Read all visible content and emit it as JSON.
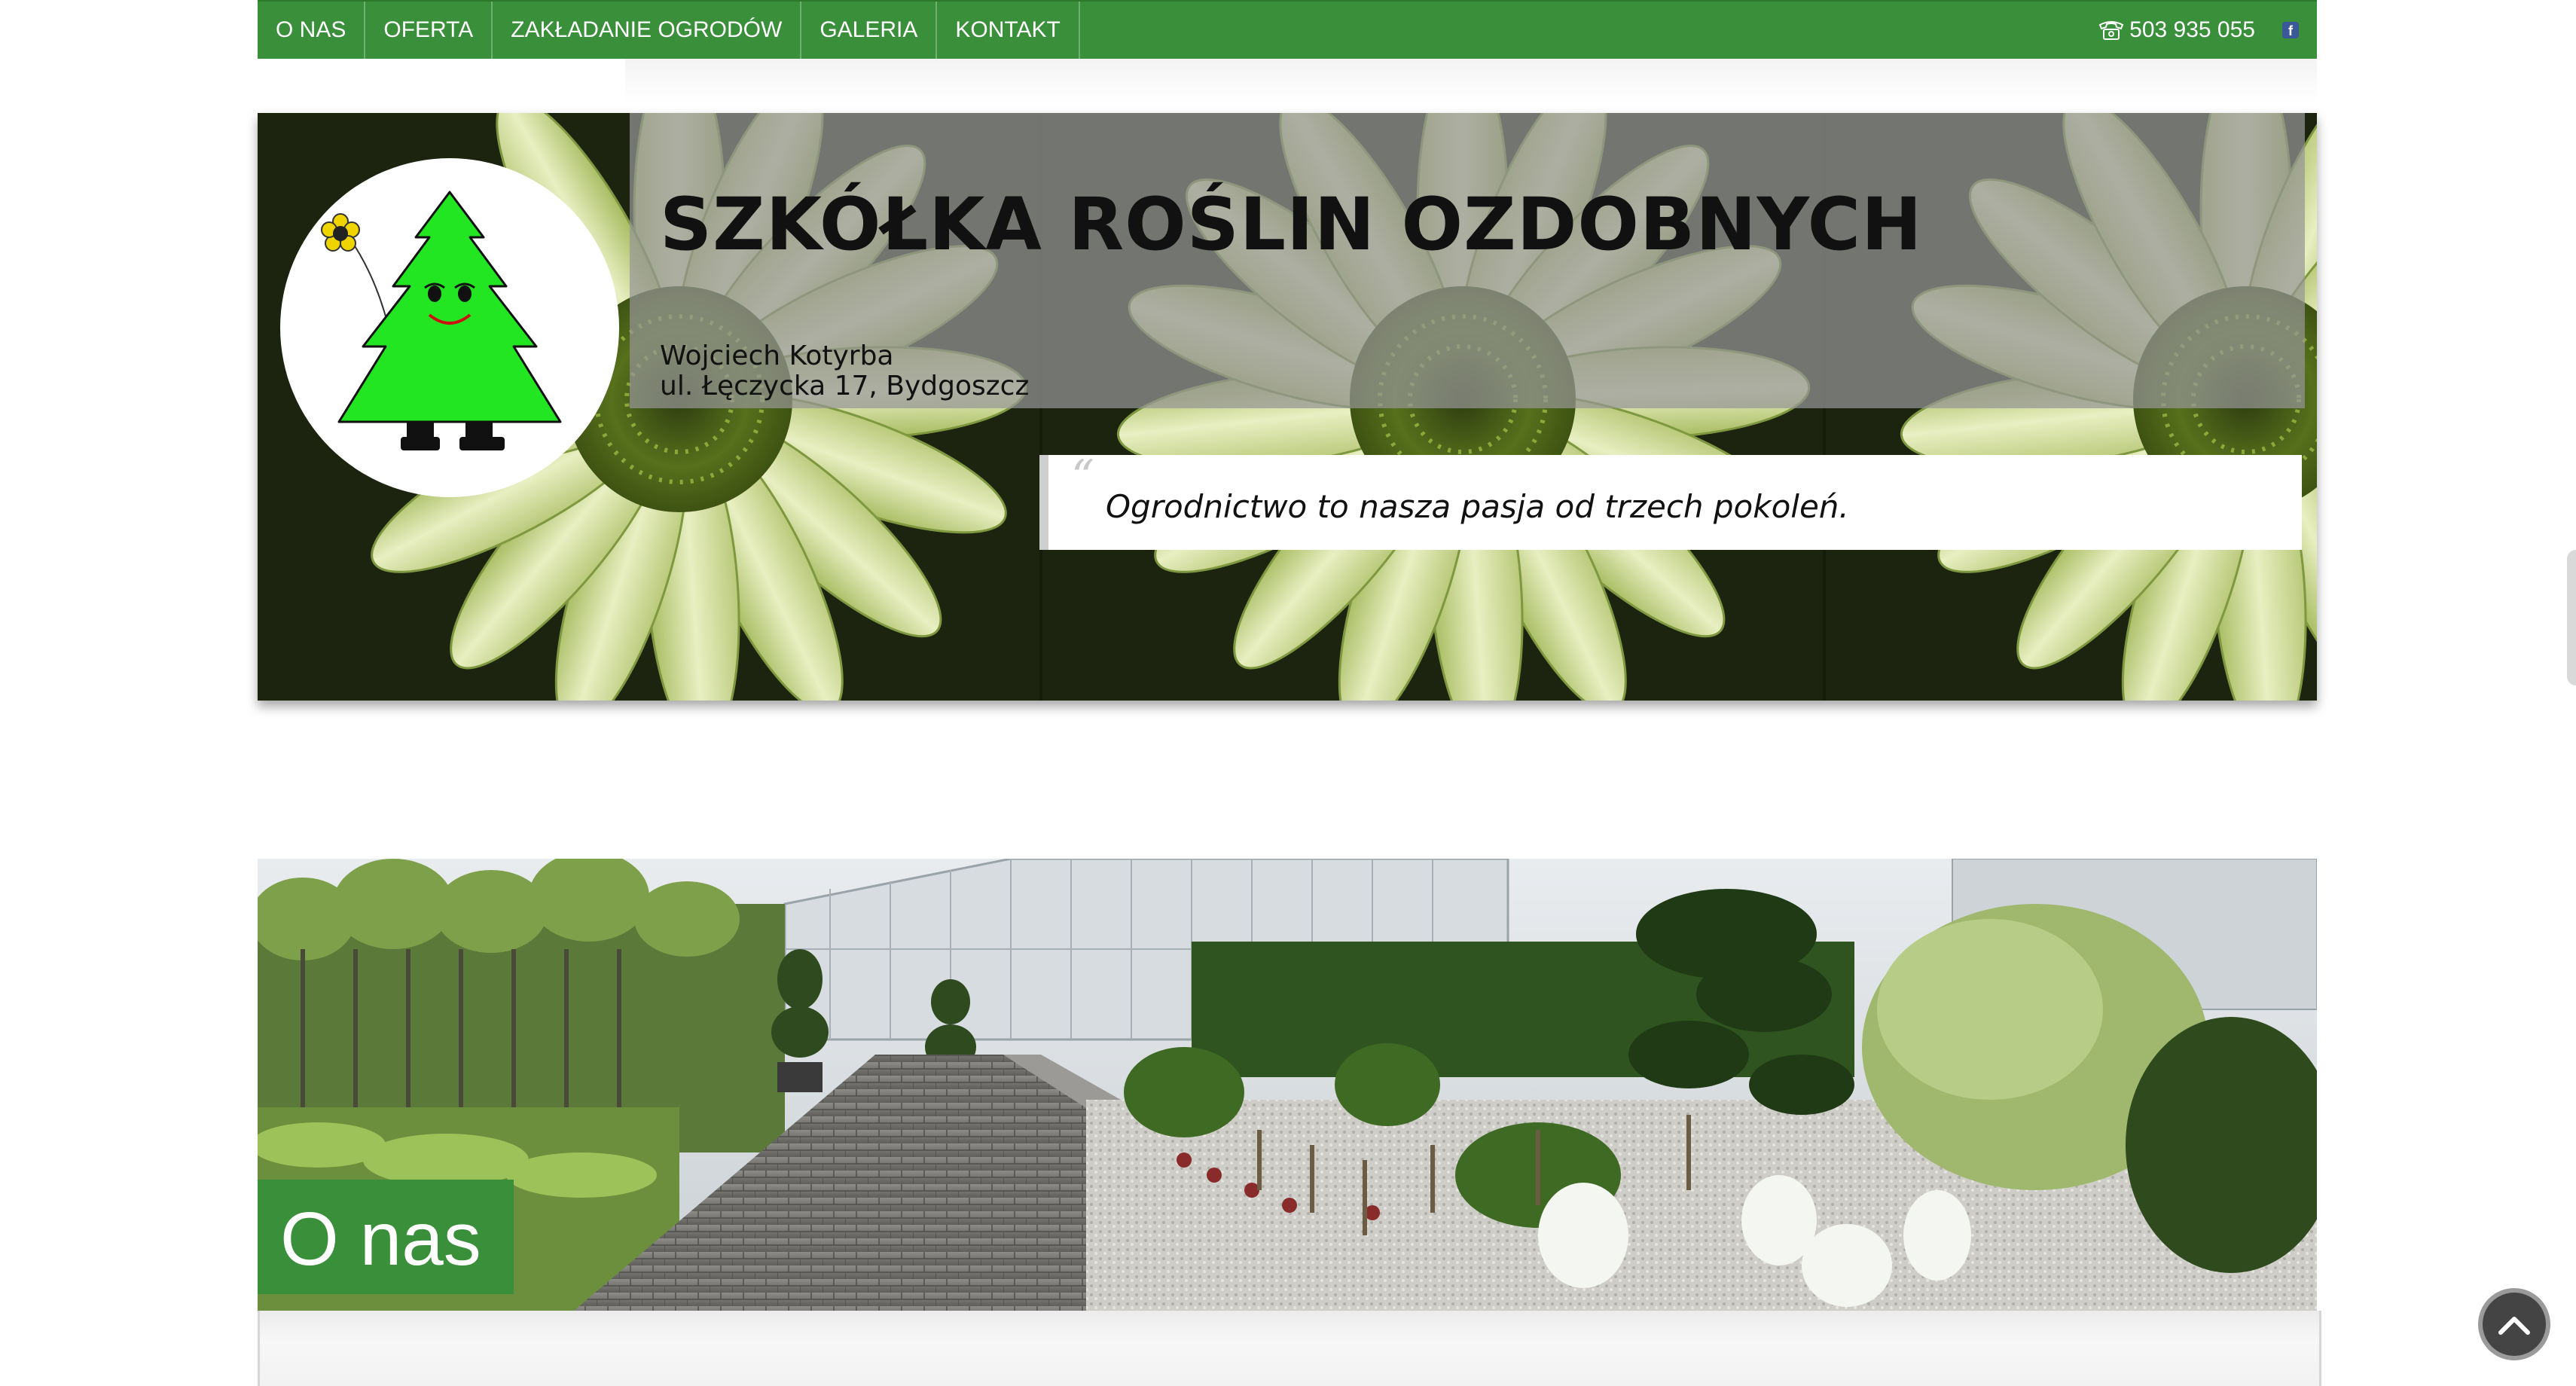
{
  "nav": {
    "items": [
      {
        "label": "O NAS"
      },
      {
        "label": "OFERTA"
      },
      {
        "label": "ZAKŁADANIE OGRODÓW"
      },
      {
        "label": "GALERIA"
      },
      {
        "label": "KONTAKT"
      }
    ],
    "phone": "503 935 055",
    "phone_icon": "phone-icon",
    "social_icon": "facebook-icon",
    "accent_color": "#3a8f3a"
  },
  "header": {
    "title": "SZKÓŁKA ROŚLIN OZDOBNYCH",
    "owner": "Wojciech Kotyrba",
    "address": "ul. Łęczycka 17, Bydgoszcz",
    "quote": "Ogrodnictwo to nasza pasja od trzech pokoleń.",
    "quote_mark": "“",
    "logo_icon": "tree-mascot-logo"
  },
  "section": {
    "title": "O nas"
  },
  "scroll_top_icon": "chevron-up-icon"
}
